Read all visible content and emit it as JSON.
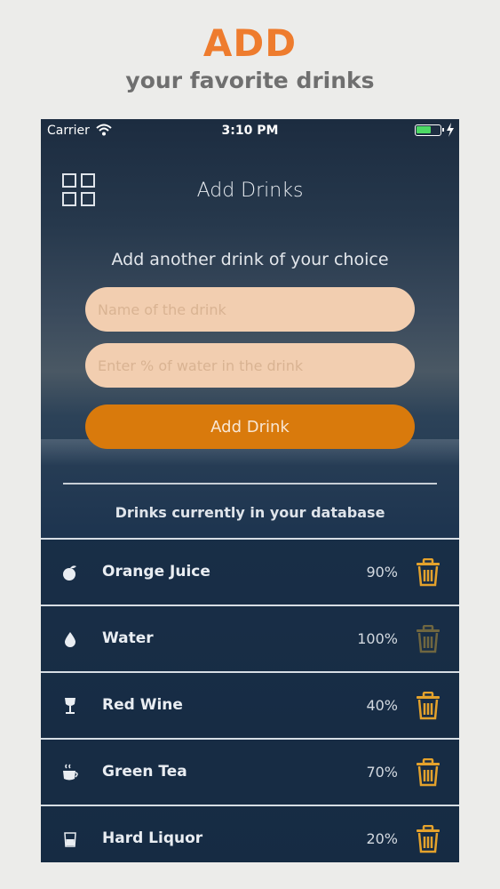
{
  "promo": {
    "title": "ADD",
    "subtitle": "your favorite drinks"
  },
  "status_bar": {
    "carrier": "Carrier",
    "time": "3:10 PM"
  },
  "header": {
    "title": "Add Drinks",
    "menu_icon": "grid-icon"
  },
  "form": {
    "subtitle": "Add another drink of your choice",
    "name_placeholder": "Name of the drink",
    "percent_placeholder": "Enter % of water in the drink",
    "button_label": "Add Drink"
  },
  "list": {
    "title": "Drinks currently in your database",
    "items": [
      {
        "name": "Orange Juice",
        "percent": "90%",
        "icon": "fruit-icon"
      },
      {
        "name": "Water",
        "percent": "100%",
        "icon": "water-drop-icon"
      },
      {
        "name": "Red Wine",
        "percent": "40%",
        "icon": "wine-glass-icon"
      },
      {
        "name": "Green Tea",
        "percent": "70%",
        "icon": "tea-cup-icon"
      },
      {
        "name": "Hard Liquor",
        "percent": "20%",
        "icon": "shot-glass-icon"
      }
    ]
  },
  "colors": {
    "accent": "#d97a0c",
    "promo_title": "#ee7c2e",
    "field_bg": "#f2ceb0",
    "trash_active": "#e4a22c",
    "trash_disabled": "#6f6640"
  }
}
